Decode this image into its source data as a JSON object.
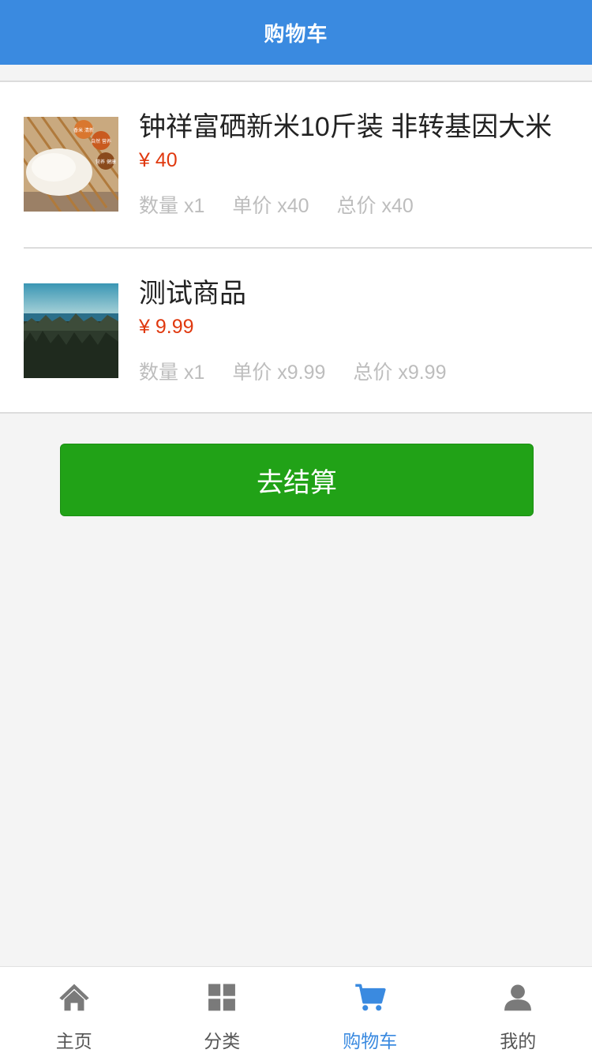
{
  "header": {
    "title": "购物车"
  },
  "cart": {
    "items": [
      {
        "name": "钟祥富硒新米10斤装 非转基因大米",
        "price": "¥ 40",
        "quantity": "数量 x1",
        "unit_price": "单价 x40",
        "total": "总价 x40",
        "badges": [
          "香米 清新",
          "自然 营养",
          "营养 健康"
        ]
      },
      {
        "name": "测试商品",
        "price": "¥ 9.99",
        "quantity": "数量 x1",
        "unit_price": "单价 x9.99",
        "total": "总价 x9.99"
      }
    ]
  },
  "checkout": {
    "label": "去结算"
  },
  "tabbar": {
    "items": [
      {
        "label": "主页",
        "icon": "home-icon"
      },
      {
        "label": "分类",
        "icon": "grid-icon"
      },
      {
        "label": "购物车",
        "icon": "cart-icon",
        "active": true
      },
      {
        "label": "我的",
        "icon": "user-icon"
      }
    ]
  },
  "colors": {
    "header": "#3a8ae0",
    "price": "#e0390f",
    "checkout": "#21a217",
    "active_tab": "#3a8ae0",
    "muted_text": "#bdbdbd"
  }
}
